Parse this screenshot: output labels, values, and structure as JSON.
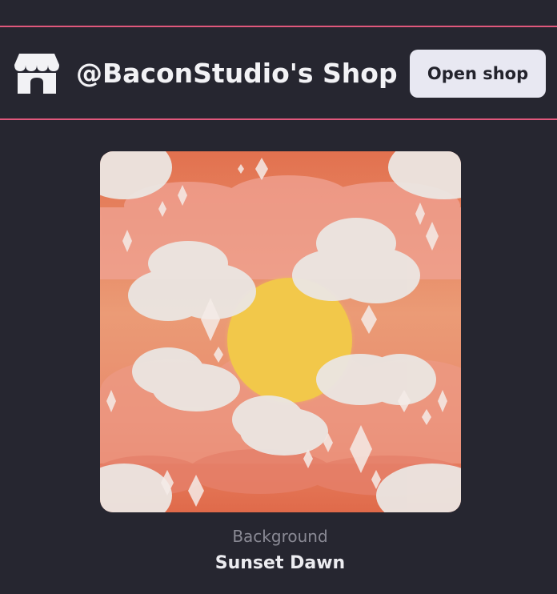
{
  "shop": {
    "title": "@BaconStudio's Shop",
    "open_button_label": "Open shop",
    "icon": "store-icon"
  },
  "item": {
    "category": "Background",
    "name": "Sunset Dawn",
    "thumbnail": "sunset-clouds-sparkles-artwork"
  },
  "colors": {
    "background": "#262630",
    "accent_border": "#e0587c",
    "button_bg": "#e8e8f2",
    "sun": "#f2c84a",
    "sky_top": "#e2714f"
  }
}
